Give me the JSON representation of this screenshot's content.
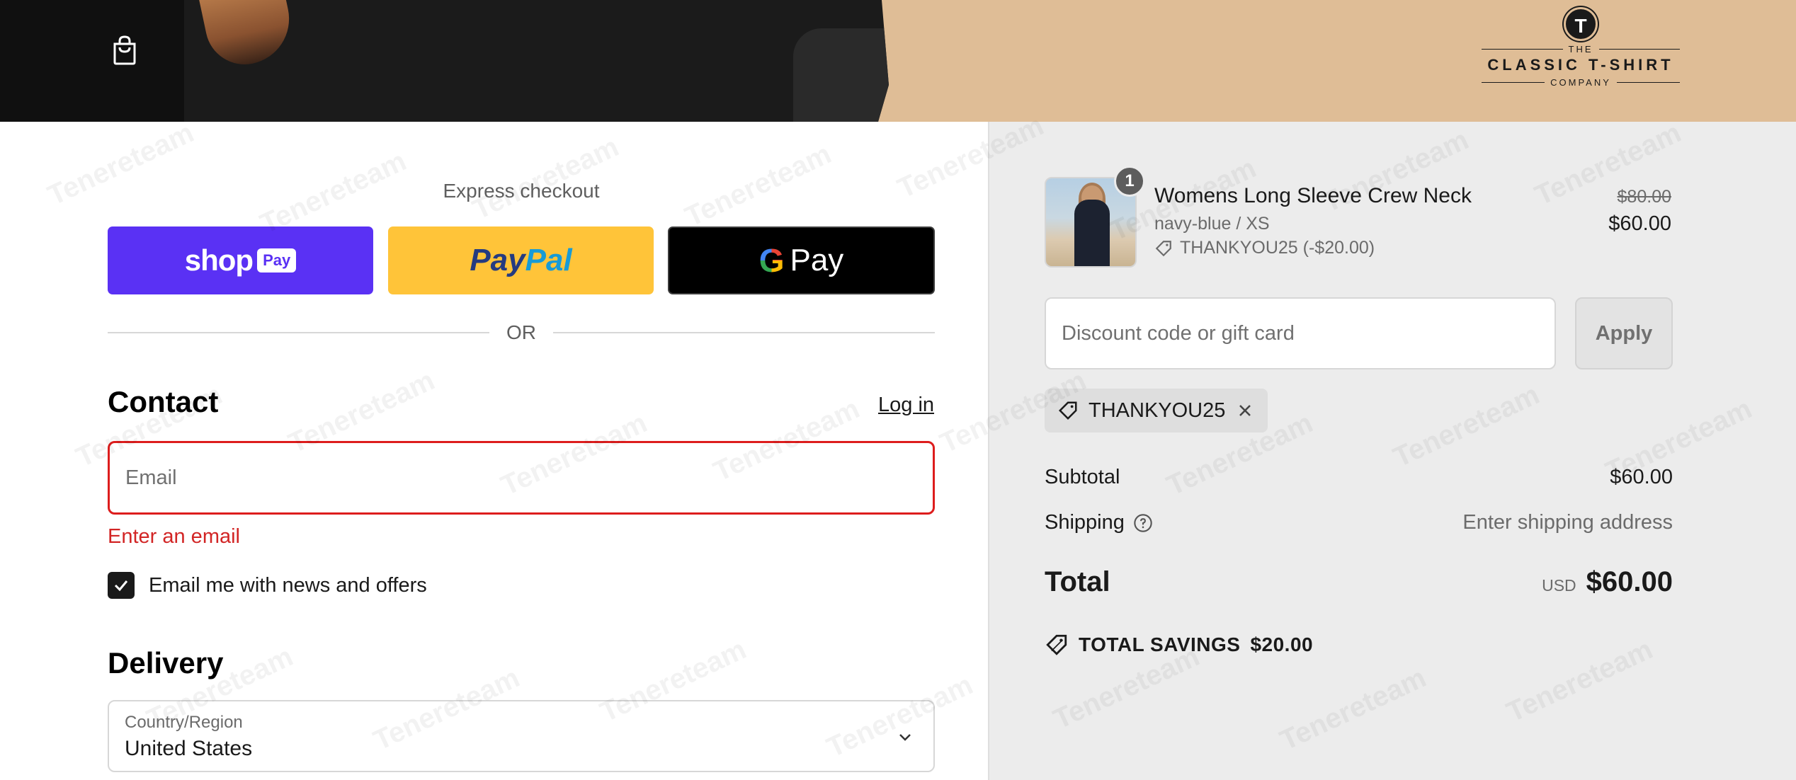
{
  "header": {
    "brand_badge": "T",
    "brand_top": "THE",
    "brand_main": "CLASSIC T-SHIRT",
    "brand_bottom": "COMPANY"
  },
  "express": {
    "title": "Express checkout",
    "shop_pay_word": "shop",
    "shop_pay_chip": "Pay",
    "paypal_a": "Pay",
    "paypal_b": "Pal",
    "gpay_g": "G",
    "gpay_word": "Pay",
    "or_label": "OR"
  },
  "contact": {
    "heading": "Contact",
    "login_link": "Log in",
    "email_placeholder": "Email",
    "email_value": "",
    "error": "Enter an email",
    "newsletter_label": "Email me with news and offers",
    "newsletter_checked": true
  },
  "delivery": {
    "heading": "Delivery",
    "country_label": "Country/Region",
    "country_value": "United States"
  },
  "summary": {
    "item": {
      "quantity": "1",
      "title": "Womens Long Sleeve Crew Neck",
      "variant": "navy-blue / XS",
      "discount": "THANKYOU25 (-$20.00)",
      "price_old": "$80.00",
      "price_new": "$60.00"
    },
    "discount_placeholder": "Discount code or gift card",
    "apply_label": "Apply",
    "applied_code": "THANKYOU25",
    "subtotal_label": "Subtotal",
    "subtotal_value": "$60.00",
    "shipping_label": "Shipping",
    "shipping_value": "Enter shipping address",
    "total_label": "Total",
    "total_currency": "USD",
    "total_value": "$60.00",
    "savings_label": "TOTAL SAVINGS",
    "savings_value": "$20.00"
  },
  "watermark": "Tenereteam",
  "colors": {
    "error": "#dd1d1d",
    "shop_pay": "#5a31f4",
    "paypal": "#ffc439",
    "banner": "#dfbd96"
  }
}
